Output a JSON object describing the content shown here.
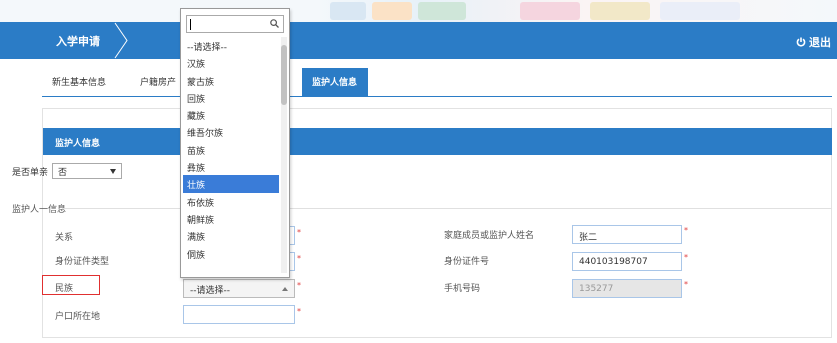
{
  "nav": {
    "title": "入学申请",
    "logout_label": "退出"
  },
  "tabs": [
    {
      "label": "新生基本信息"
    },
    {
      "label": "户籍房产"
    },
    {
      "label": "监护人信息"
    }
  ],
  "guardian_panel": {
    "title": "监护人信息",
    "single_parent_label": "是否单亲",
    "single_parent_value": "否",
    "section_title": "监护人一信息",
    "relation_label": "关系",
    "id_type_label": "身份证件类型",
    "ethnicity_label": "民族",
    "ethnicity_value": "--请选择--",
    "hukou_label": "户口所在地",
    "member_name_label": "家庭成员或监护人姓名",
    "member_name_value": "张二",
    "id_number_label": "身份证件号",
    "id_number_value": "440103198707",
    "phone_label": "手机号码",
    "phone_value": "135277"
  },
  "ethnicity_dropdown": {
    "search_value": "",
    "selected": "壮族",
    "options": [
      "--请选择--",
      "汉族",
      "蒙古族",
      "回族",
      "藏族",
      "维吾尔族",
      "苗族",
      "彝族",
      "壮族",
      "布依族",
      "朝鲜族",
      "满族",
      "侗族"
    ]
  },
  "colors": {
    "primary": "#2b7cc6",
    "highlight_border": "#e03030",
    "required": "#e04040",
    "dropdown_selected": "#3a7cd8"
  },
  "icons": {
    "logout": "power-icon",
    "dropdown_search": "search-icon",
    "select_arrow": "caret-down-icon"
  }
}
